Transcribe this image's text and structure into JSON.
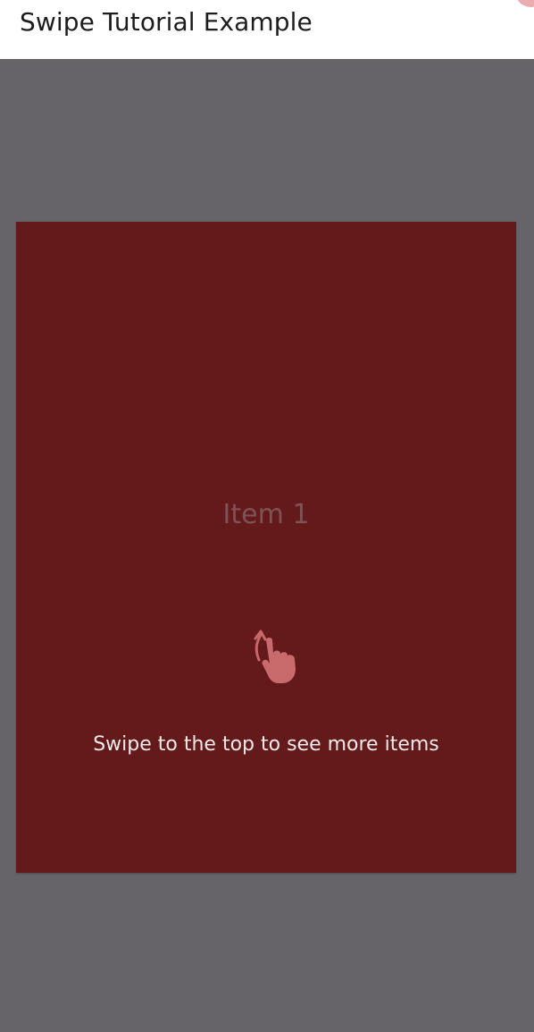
{
  "app_bar": {
    "title": "Swipe Tutorial Example"
  },
  "card": {
    "item_label": "Item 1",
    "background_color": "#641a1b"
  },
  "tutorial": {
    "hint_text": "Swipe to the top to see more items",
    "gesture_icon": "swipe-up-hand-icon"
  },
  "colors": {
    "overlay": "#666468",
    "app_bar": "#ffffff"
  }
}
